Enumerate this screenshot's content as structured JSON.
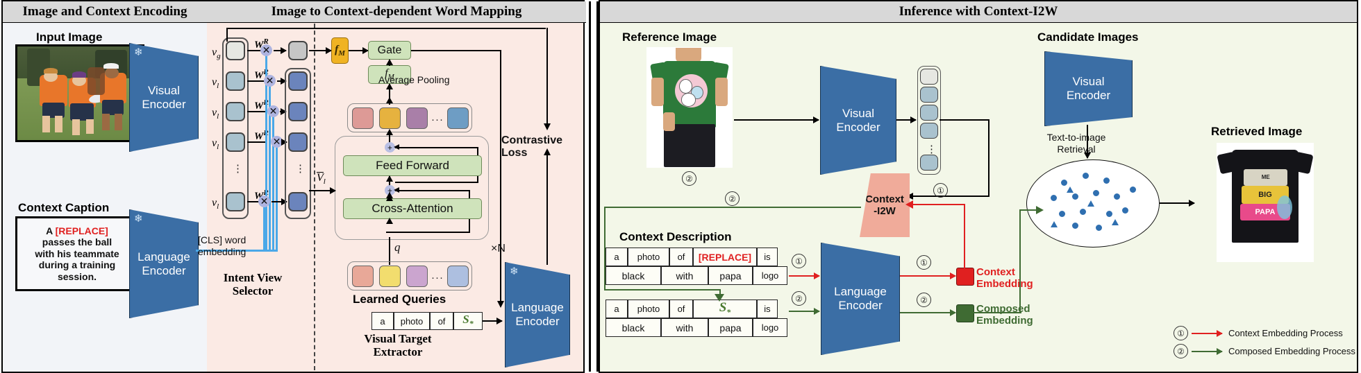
{
  "panels": {
    "left": {
      "title": "Image and Context Encoding"
    },
    "mid": {
      "title": "Image to Context-dependent Word Mapping"
    },
    "right": {
      "title": "Inference with Context-I2W"
    }
  },
  "left_panel": {
    "input_image_label": "Input Image",
    "visual_encoder": "Visual\nEncoder",
    "visual_encoder_line1": "Visual",
    "visual_encoder_line2": "Encoder",
    "context_caption_label": "Context Caption",
    "caption_prefix": "A ",
    "caption_replace": "[REPLACE]",
    "caption_rest": "passes the ball with his teammate during a training session.",
    "caption_lines": [
      "passes the ball",
      "with his teammate",
      "during a training",
      "session."
    ],
    "language_encoder_line1": "Language",
    "language_encoder_line2": "Encoder",
    "snowflake_icon": "snowflake-icon"
  },
  "mid_panel": {
    "vg_label": "v",
    "vg_sub": "g",
    "vl_label": "v",
    "vl_sub": "l",
    "wr_label": "W",
    "wr_sup": "R",
    "cls_word_embedding_line1": "[CLS] word",
    "cls_word_embedding_line2": "embedding",
    "intent_view_selector_line1": "Intent View",
    "intent_view_selector_line2": "Selector",
    "v_tilde": "V",
    "v_tilde_sub": "l",
    "fm_gold": "f",
    "fm_gold_sub": "M",
    "gate_label": "Gate",
    "fm_green": "f",
    "fm_green_sub": "M",
    "average_pooling": "Average Pooling",
    "feed_forward": "Feed Forward",
    "cross_attention": "Cross-Attention",
    "q_label": "q",
    "xN_label": "×N",
    "learned_queries": "Learned Queries",
    "sentence_tokens": [
      "a",
      "photo",
      "of"
    ],
    "s_star": "S",
    "s_star_sub": "*",
    "visual_target_extractor_line1": "Visual Target",
    "visual_target_extractor_line2": "Extractor",
    "contrastive_loss": "Contrastive Loss",
    "language_encoder_line1": "Language",
    "language_encoder_line2": "Encoder",
    "query_colors": [
      "#dd9a96",
      "#e6b23f",
      "#a97fa8",
      "#6e9dc4"
    ],
    "learned_query_colors": [
      "#e8a898",
      "#f2dd6e",
      "#cba5cf",
      "#adbfe0"
    ],
    "local_cell_color": "#6b84bc",
    "global_cell_color": "#c6c6c6",
    "v_cell_color": "#a9c2ce"
  },
  "right_panel": {
    "reference_image_label": "Reference Image",
    "candidate_images_label": "Candidate Images",
    "retrieved_image_label": "Retrieved Image",
    "visual_encoder_line1": "Visual",
    "visual_encoder_line2": "Encoder",
    "context_i2w_line1": "Context",
    "context_i2w_line2": "-I2W",
    "text_to_image_line1": "Text-to-image",
    "text_to_image_line2": "Retrieval",
    "context_description_label": "Context Description",
    "row1_tokens_line1": [
      "a",
      "photo",
      "of",
      "[REPLACE]",
      "is"
    ],
    "row1_tokens_line2": [
      "black",
      "with",
      "papa",
      "logo"
    ],
    "row2_tokens_line1": [
      "a",
      "photo",
      "of",
      "S*",
      "is"
    ],
    "row2_tokens_line2": [
      "black",
      "with",
      "papa",
      "logo"
    ],
    "s_star": "S",
    "s_star_sub": "*",
    "replace_token": "[REPLACE]",
    "language_encoder_line1": "Language",
    "language_encoder_line2": "Encoder",
    "context_embedding_line1": "Context",
    "context_embedding_line2": "Embedding",
    "composed_embedding_line1": "Composed",
    "composed_embedding_line2": "Embedding",
    "legend": [
      {
        "num": "①",
        "text": "Context Embedding Process",
        "color": "#e02020"
      },
      {
        "num": "②",
        "text": "Composed Embedding Process",
        "color": "#3f6b33"
      }
    ],
    "marker_one": "①",
    "marker_two": "②",
    "shirt_text_line1": "ME",
    "shirt_text_line2": "BIG",
    "shirt_text_line3": "PAPA"
  },
  "colors": {
    "header_bg": "#d8d8d8",
    "left_panel_bg": "#f2f4f8",
    "mid_panel_bg": "#fbeae4",
    "right_panel_bg": "#f3f7e8",
    "encoder_blue": "#3b6ea5",
    "context_i2w_pink": "#f0ab9a",
    "replace_red": "#e02020",
    "s_star_green": "#4a7a30",
    "gate_green": "#cfe3bb",
    "fm_gold": "#f0b323"
  }
}
